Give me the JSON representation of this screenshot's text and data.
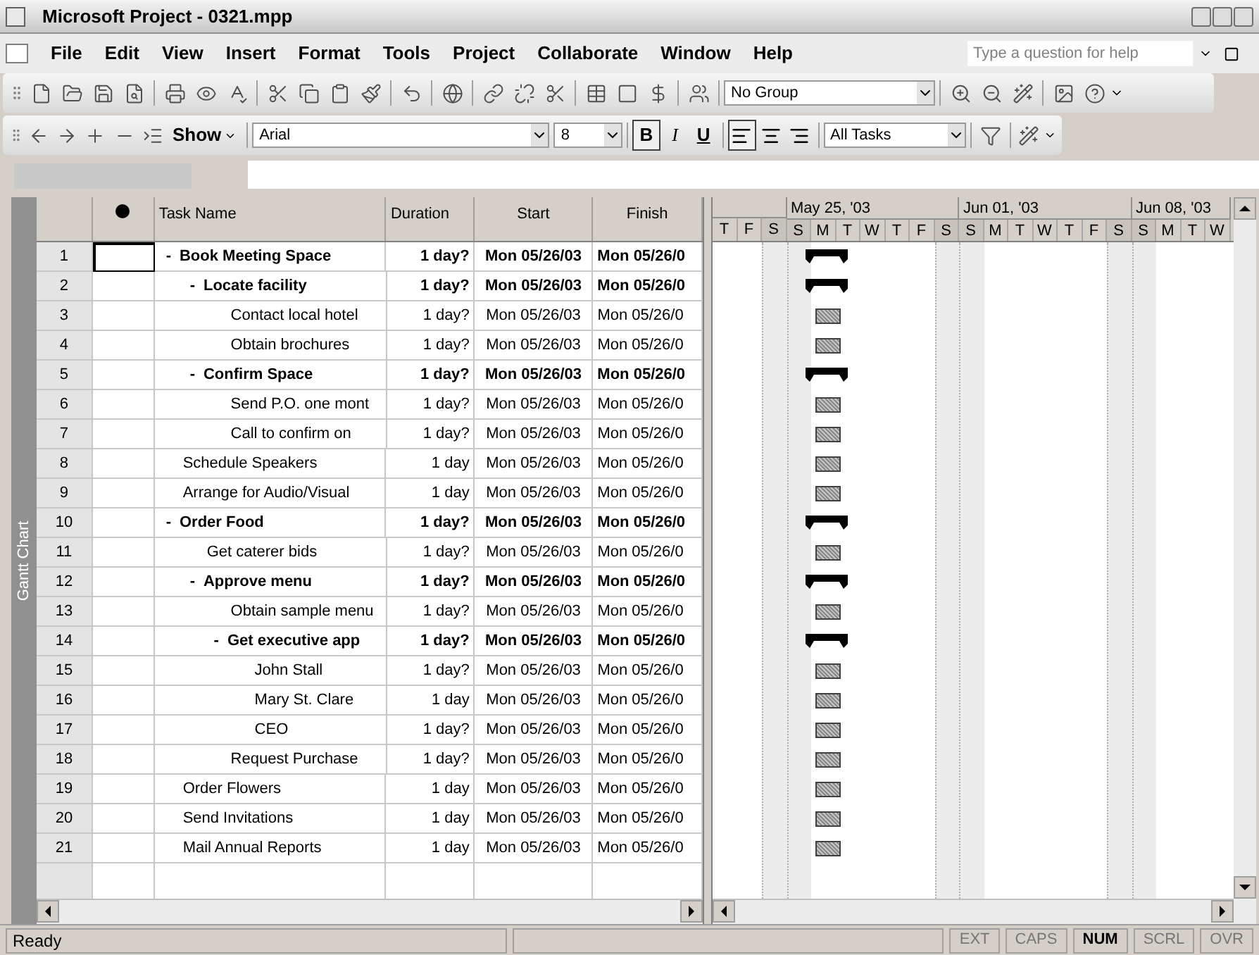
{
  "window": {
    "title": "Microsoft Project - 0321.mpp"
  },
  "menu": [
    "File",
    "Edit",
    "View",
    "Insert",
    "Format",
    "Tools",
    "Project",
    "Collaborate",
    "Window",
    "Help"
  ],
  "help_box": {
    "placeholder": "Type a question for help"
  },
  "standard_toolbar": {
    "group_dropdown": "No Group"
  },
  "formatting_toolbar": {
    "show_button": "Show",
    "font": "Arial",
    "font_size": "8",
    "style_buttons": [
      {
        "label": "B",
        "kind": "bold",
        "pressed": true
      },
      {
        "label": "I",
        "kind": "italic",
        "pressed": false
      },
      {
        "label": "U",
        "kind": "underline",
        "pressed": false
      }
    ],
    "align_buttons": [
      {
        "kind": "left",
        "pressed": true
      },
      {
        "kind": "center",
        "pressed": false
      },
      {
        "kind": "right",
        "pressed": false
      }
    ],
    "filter_dropdown": "All Tasks"
  },
  "view_bar": {
    "label": "Gantt Chart"
  },
  "table": {
    "columns": [
      "Task Name",
      "Duration",
      "Start",
      "Finish"
    ],
    "rows": [
      {
        "id": "1",
        "name": "Book Meeting Space",
        "kind": "summary",
        "toggle": "-",
        "duration": "1 day?",
        "start": "Mon 05/26/03",
        "finish": "Mon 05/26/0",
        "selected": true,
        "children": [
          {
            "id": "2",
            "name": "Locate facility",
            "kind": "summary",
            "toggle": "-",
            "duration": "1 day?",
            "start": "Mon 05/26/03",
            "finish": "Mon 05/26/0",
            "selected": false,
            "children": [
              {
                "id": "3",
                "name": "Contact local hotel",
                "kind": "task",
                "duration": "1 day?",
                "start": "Mon 05/26/03",
                "finish": "Mon 05/26/0",
                "selected": false
              },
              {
                "id": "4",
                "name": "Obtain brochures",
                "kind": "task",
                "duration": "1 day?",
                "start": "Mon 05/26/03",
                "finish": "Mon 05/26/0",
                "selected": false
              }
            ]
          },
          {
            "id": "5",
            "name": "Confirm Space",
            "kind": "summary",
            "toggle": "-",
            "duration": "1 day?",
            "start": "Mon 05/26/03",
            "finish": "Mon 05/26/0",
            "selected": false,
            "children": [
              {
                "id": "6",
                "name": "Send P.O. one mont",
                "kind": "task",
                "duration": "1 day?",
                "start": "Mon 05/26/03",
                "finish": "Mon 05/26/0",
                "selected": false
              },
              {
                "id": "7",
                "name": "Call to confirm on",
                "kind": "task",
                "duration": "1 day?",
                "start": "Mon 05/26/03",
                "finish": "Mon 05/26/0",
                "selected": false
              }
            ]
          }
        ]
      },
      {
        "id": "8",
        "name": "Schedule Speakers",
        "kind": "task",
        "duration": "1 day",
        "start": "Mon 05/26/03",
        "finish": "Mon 05/26/0",
        "selected": false
      },
      {
        "id": "9",
        "name": "Arrange for Audio/Visual",
        "kind": "task",
        "duration": "1 day",
        "start": "Mon 05/26/03",
        "finish": "Mon 05/26/0",
        "selected": false
      },
      {
        "id": "10",
        "name": "Order Food",
        "kind": "summary",
        "toggle": "-",
        "duration": "1 day?",
        "start": "Mon 05/26/03",
        "finish": "Mon 05/26/0",
        "selected": false,
        "children": [
          {
            "id": "11",
            "name": "Get caterer bids",
            "kind": "task",
            "duration": "1 day?",
            "start": "Mon 05/26/03",
            "finish": "Mon 05/26/0",
            "selected": false
          },
          {
            "id": "12",
            "name": "Approve menu",
            "kind": "summary",
            "toggle": "-",
            "duration": "1 day?",
            "start": "Mon 05/26/03",
            "finish": "Mon 05/26/0",
            "selected": false,
            "children": [
              {
                "id": "13",
                "name": "Obtain sample menu",
                "kind": "task",
                "duration": "1 day?",
                "start": "Mon 05/26/03",
                "finish": "Mon 05/26/0",
                "selected": false
              },
              {
                "id": "14",
                "name": "Get executive app",
                "kind": "summary",
                "toggle": "-",
                "duration": "1 day?",
                "start": "Mon 05/26/03",
                "finish": "Mon 05/26/0",
                "selected": false,
                "children": [
                  {
                    "id": "15",
                    "name": "John Stall",
                    "kind": "task",
                    "duration": "1 day?",
                    "start": "Mon 05/26/03",
                    "finish": "Mon 05/26/0",
                    "selected": false
                  },
                  {
                    "id": "16",
                    "name": "Mary St. Clare",
                    "kind": "task",
                    "duration": "1 day",
                    "start": "Mon 05/26/03",
                    "finish": "Mon 05/26/0",
                    "selected": false
                  },
                  {
                    "id": "17",
                    "name": "CEO",
                    "kind": "task",
                    "duration": "1 day?",
                    "start": "Mon 05/26/03",
                    "finish": "Mon 05/26/0",
                    "selected": false
                  }
                ]
              },
              {
                "id": "18",
                "name": "Request Purchase",
                "kind": "task",
                "duration": "1 day?",
                "start": "Mon 05/26/03",
                "finish": "Mon 05/26/0",
                "selected": false
              }
            ]
          }
        ]
      },
      {
        "id": "19",
        "name": "Order Flowers",
        "kind": "task",
        "duration": "1 day",
        "start": "Mon 05/26/03",
        "finish": "Mon 05/26/0",
        "selected": false
      },
      {
        "id": "20",
        "name": "Send Invitations",
        "kind": "task",
        "duration": "1 day",
        "start": "Mon 05/26/03",
        "finish": "Mon 05/26/0",
        "selected": false
      },
      {
        "id": "21",
        "name": "Mail Annual Reports",
        "kind": "task",
        "duration": "1 day",
        "start": "Mon 05/26/03",
        "finish": "Mon 05/26/0",
        "selected": false
      }
    ]
  },
  "timescale": {
    "weeks": [
      {
        "days": [
          {
            "letter": "T",
            "nonworking": false
          },
          {
            "letter": "F",
            "nonworking": false
          },
          {
            "letter": "S",
            "nonworking": true
          }
        ]
      },
      {
        "label": "May 25, '03",
        "days": [
          {
            "letter": "S",
            "nonworking": true
          },
          {
            "letter": "M",
            "nonworking": false
          },
          {
            "letter": "T",
            "nonworking": false
          },
          {
            "letter": "W",
            "nonworking": false
          },
          {
            "letter": "T",
            "nonworking": false
          },
          {
            "letter": "F",
            "nonworking": false
          },
          {
            "letter": "S",
            "nonworking": true
          }
        ]
      },
      {
        "label": "Jun 01, '03",
        "days": [
          {
            "letter": "S",
            "nonworking": true
          },
          {
            "letter": "M",
            "nonworking": false
          },
          {
            "letter": "T",
            "nonworking": false
          },
          {
            "letter": "W",
            "nonworking": false
          },
          {
            "letter": "T",
            "nonworking": false
          },
          {
            "letter": "F",
            "nonworking": false
          },
          {
            "letter": "S",
            "nonworking": true
          }
        ]
      },
      {
        "label": "Jun 08, '03",
        "days": [
          {
            "letter": "S",
            "nonworking": true
          },
          {
            "letter": "M",
            "nonworking": false
          },
          {
            "letter": "T",
            "nonworking": false
          },
          {
            "letter": "W",
            "nonworking": false
          }
        ]
      }
    ]
  },
  "status_bar": {
    "text": "Ready",
    "indicators": [
      {
        "label": "EXT",
        "active": false
      },
      {
        "label": "CAPS",
        "active": false
      },
      {
        "label": "NUM",
        "active": true
      },
      {
        "label": "SCRL",
        "active": false
      },
      {
        "label": "OVR",
        "active": false
      }
    ]
  }
}
